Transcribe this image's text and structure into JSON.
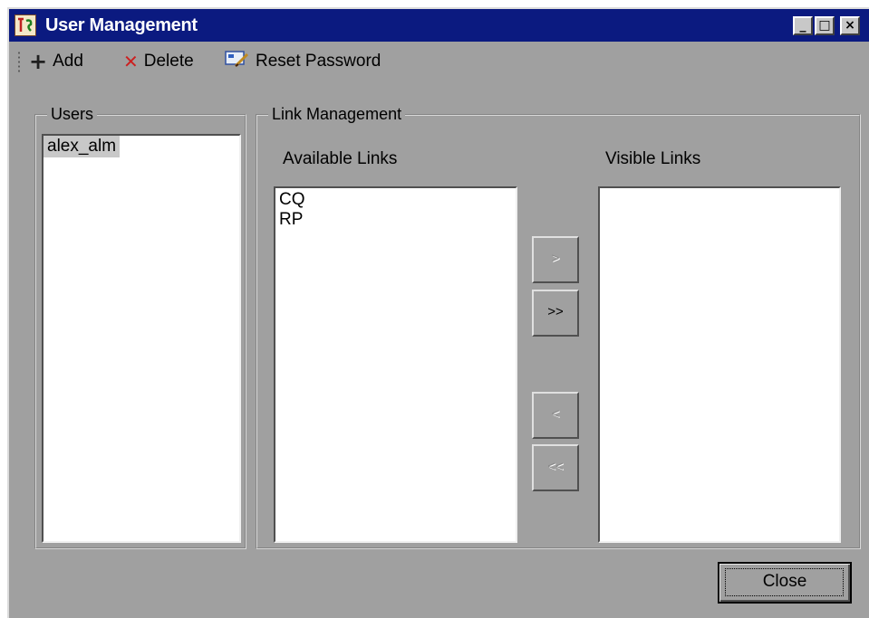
{
  "window": {
    "title": "User Management",
    "controls": {
      "minimize": "_",
      "maximize": "□",
      "close": "×"
    }
  },
  "toolbar": {
    "add_label": "Add",
    "delete_label": "Delete",
    "reset_password_label": "Reset Password",
    "icons": {
      "add": "plus-icon",
      "delete": "x-icon",
      "reset_password": "key-card-icon"
    }
  },
  "users": {
    "legend": "Users",
    "items": [
      "alex_alm"
    ],
    "selected": "alex_alm"
  },
  "links": {
    "legend": "Link Management",
    "available_label": "Available Links",
    "visible_label": "Visible Links",
    "available_items": [
      "CQ",
      "RP"
    ],
    "visible_items": [],
    "buttons": {
      "add_one": ">",
      "add_all": ">>",
      "remove_one": "<",
      "remove_all": "<<"
    }
  },
  "footer": {
    "close_label": "Close"
  },
  "colors": {
    "titlebar": "#0b1a80",
    "window_bg": "#a0a0a0",
    "list_bg": "#ffffff",
    "delete_icon": "#cc2020"
  }
}
